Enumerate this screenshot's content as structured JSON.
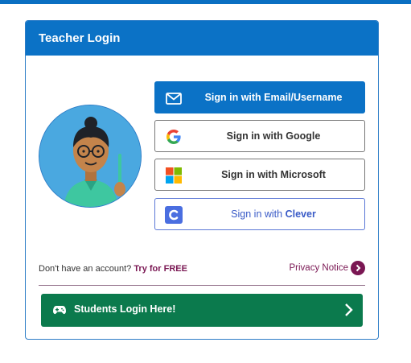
{
  "header": {
    "title": "Teacher Login"
  },
  "buttons": {
    "email": "Sign in with Email/Username",
    "google": "Sign in with Google",
    "microsoft": "Sign in with Microsoft",
    "clever_prefix": "Sign in with",
    "clever_brand": "Clever"
  },
  "footer": {
    "no_account": "Don't have an account?",
    "try_free": "Try for FREE",
    "privacy": "Privacy Notice"
  },
  "students": {
    "label": "Students Login Here!"
  },
  "icons": {
    "email": "envelope-icon",
    "google": "google-logo-icon",
    "microsoft": "microsoft-logo-icon",
    "clever": "clever-logo-icon",
    "privacy": "chevron-right-circle-icon",
    "students": "gamepad-icon",
    "students_arrow": "chevron-right-icon"
  },
  "colors": {
    "primary": "#0b72c6",
    "students_green": "#0b7a4d",
    "link_purple": "#7a1753",
    "clever_blue": "#3a5bc7"
  }
}
